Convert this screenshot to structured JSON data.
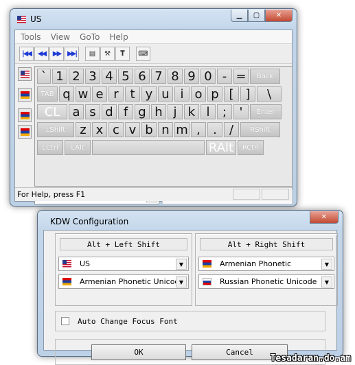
{
  "main_window": {
    "title": "US",
    "title_flag": "us-flag",
    "menu": [
      "Tools",
      "View",
      "GoTo",
      "Help"
    ],
    "toolbar_nav": [
      "first-icon",
      "prev-icon",
      "next-icon",
      "last-icon"
    ],
    "toolbar_tools": [
      "properties-icon",
      "tools-icon",
      "font-icon",
      "keyboard-icon"
    ],
    "sidebar_flags": [
      "us-flag",
      "am-flag",
      "am-flag",
      "am-flag"
    ],
    "keyboard": {
      "row1": [
        "`",
        "1",
        "2",
        "3",
        "4",
        "5",
        "6",
        "7",
        "8",
        "9",
        "0",
        "-",
        "=",
        "Back"
      ],
      "row2": [
        "TAB",
        "q",
        "w",
        "e",
        "r",
        "t",
        "y",
        "u",
        "i",
        "o",
        "p",
        "[",
        "]",
        "\\"
      ],
      "row3": [
        "CL",
        "a",
        "s",
        "d",
        "f",
        "g",
        "h",
        "j",
        "k",
        "l",
        ";",
        "'",
        "Enter"
      ],
      "row4": [
        "LShift",
        "z",
        "x",
        "c",
        "v",
        "b",
        "n",
        "m",
        ",",
        ".",
        "/",
        "RShift"
      ],
      "row5": [
        "LCtrl",
        "LAlt",
        "",
        "RAlt",
        "RCtrl"
      ]
    },
    "layout_select": {
      "value": "US",
      "flag": "us-flag"
    },
    "status_text": "For Help, press F1"
  },
  "config_dialog": {
    "title": "KDW Configuration",
    "left_group": {
      "header": "Alt + Left Shift",
      "combo1": {
        "value": "US",
        "flag": "us-flag"
      },
      "combo2": {
        "value": "Armenian Phonetic Unicode",
        "flag": "am-flag"
      }
    },
    "right_group": {
      "header": "Alt + Right Shift",
      "combo1": {
        "value": "Armenian Phonetic",
        "flag": "am-flag"
      },
      "combo2": {
        "value": "Russian Phonetic Unicode",
        "flag": "ru-flag"
      }
    },
    "checkbox_label": "Auto Change Focus Font",
    "checkbox_checked": false,
    "ok_label": "OK",
    "cancel_label": "Cancel"
  },
  "watermark": "Tesadaran.do.am"
}
